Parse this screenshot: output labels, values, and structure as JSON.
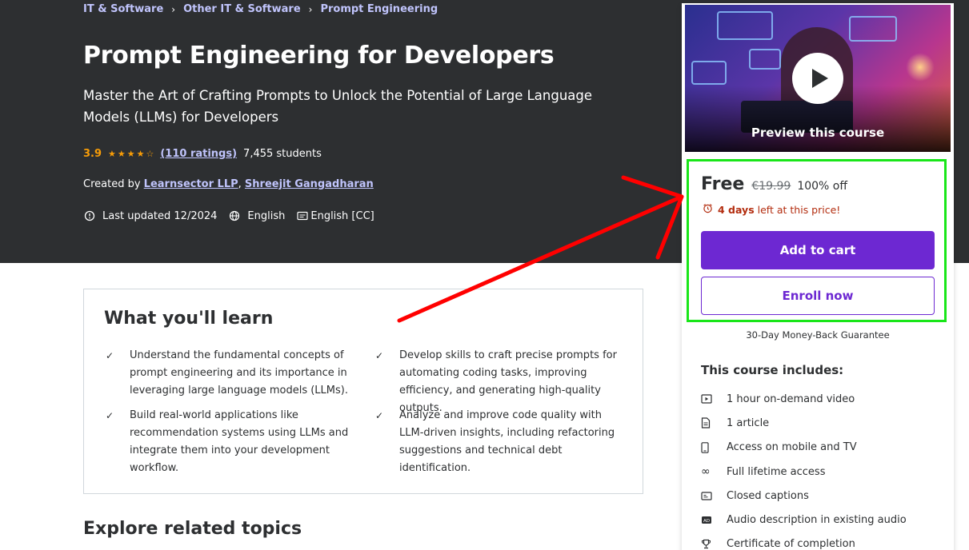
{
  "breadcrumb": [
    "IT & Software",
    "Other IT & Software",
    "Prompt Engineering"
  ],
  "course": {
    "title": "Prompt Engineering for Developers",
    "subtitle": "Master the Art of Crafting Prompts to Unlock the Potential of Large Language Models (LLMs) for Developers",
    "rating": "3.9",
    "rating_stars": 3.9,
    "ratings_count": "(110 ratings)",
    "students": "7,455 students",
    "created_by_label": "Created by",
    "authors": [
      "Learnsector LLP",
      "Shreejit Gangadharan"
    ],
    "last_updated": "Last updated 12/2024",
    "language": "English",
    "captions": "English [CC]"
  },
  "learn": {
    "title": "What you'll learn",
    "items": [
      "Understand the fundamental concepts of prompt engineering and its importance in leveraging large language models (LLMs).",
      "Develop skills to craft precise prompts for automating coding tasks, improving efficiency, and generating high-quality outputs.",
      "Build real-world applications like recommendation systems using LLMs and integrate them into your development workflow.",
      "Analyze and improve code quality with LLM-driven insights, including refactoring suggestions and technical debt identification."
    ]
  },
  "explore_title": "Explore related topics",
  "sidebar": {
    "preview_label": "Preview this course",
    "price": "Free",
    "original_price": "€19.99",
    "discount": "100% off",
    "timer_days": "4 days",
    "timer_rest": "left at this price!",
    "add_to_cart": "Add to cart",
    "enroll_now": "Enroll now",
    "guarantee": "30-Day Money-Back Guarantee",
    "includes_title": "This course includes:",
    "includes": [
      {
        "icon": "video-icon",
        "label": "1 hour on-demand video"
      },
      {
        "icon": "article-icon",
        "label": "1 article"
      },
      {
        "icon": "mobile-icon",
        "label": "Access on mobile and TV"
      },
      {
        "icon": "infinity-icon",
        "label": "Full lifetime access"
      },
      {
        "icon": "captions-icon",
        "label": "Closed captions"
      },
      {
        "icon": "audio-description-icon",
        "label": "Audio description in existing audio"
      },
      {
        "icon": "trophy-icon",
        "label": "Certificate of completion"
      }
    ]
  },
  "colors": {
    "hero_bg": "#2d2f31",
    "accent_purple": "#6d28d2",
    "link_lavender": "#c0c4fc",
    "rating_orange": "#f69c08",
    "timer_red": "#b32d0f",
    "annotation_red": "#ff0000",
    "annotation_green": "#19e619"
  }
}
